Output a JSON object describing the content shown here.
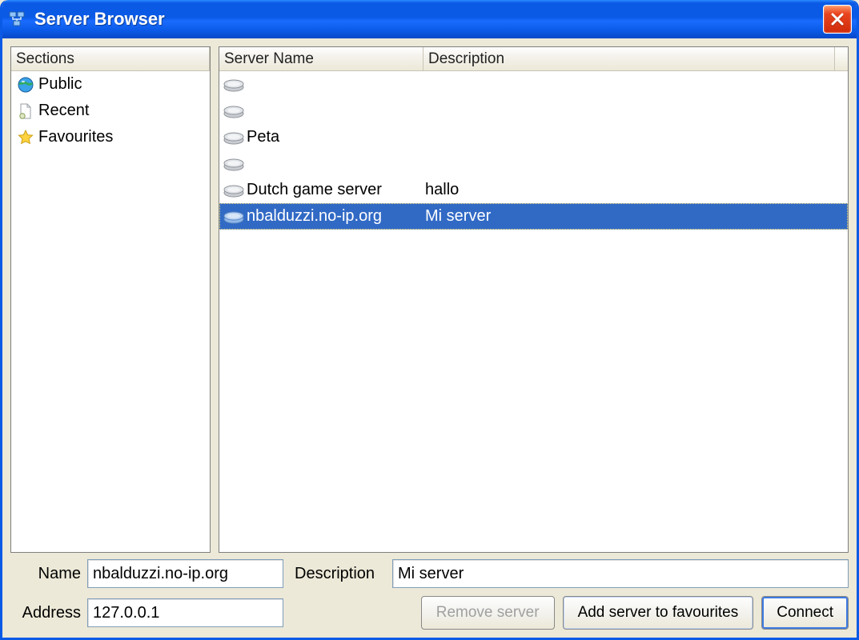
{
  "window": {
    "title": "Server Browser"
  },
  "sidebar": {
    "header": "Sections",
    "items": [
      {
        "label": "Public",
        "icon": "globe-icon"
      },
      {
        "label": "Recent",
        "icon": "document-icon"
      },
      {
        "label": "Favourites",
        "icon": "star-icon"
      }
    ]
  },
  "server_list": {
    "columns": {
      "name": "Server Name",
      "description": "Description"
    },
    "rows": [
      {
        "name": "",
        "description": "",
        "selected": false
      },
      {
        "name": "",
        "description": "",
        "selected": false
      },
      {
        "name": "Peta",
        "description": "",
        "selected": false
      },
      {
        "name": "",
        "description": "",
        "selected": false
      },
      {
        "name": "Dutch game server",
        "description": "hallo",
        "selected": false
      },
      {
        "name": "nbalduzzi.no-ip.org",
        "description": "Mi server",
        "selected": true
      }
    ]
  },
  "form": {
    "labels": {
      "name": "Name",
      "description": "Description",
      "address": "Address"
    },
    "values": {
      "name": "nbalduzzi.no-ip.org",
      "description": "Mi server",
      "address": "127.0.0.1"
    }
  },
  "buttons": {
    "remove": "Remove server",
    "add_fav": "Add server to favourites",
    "connect": "Connect"
  }
}
